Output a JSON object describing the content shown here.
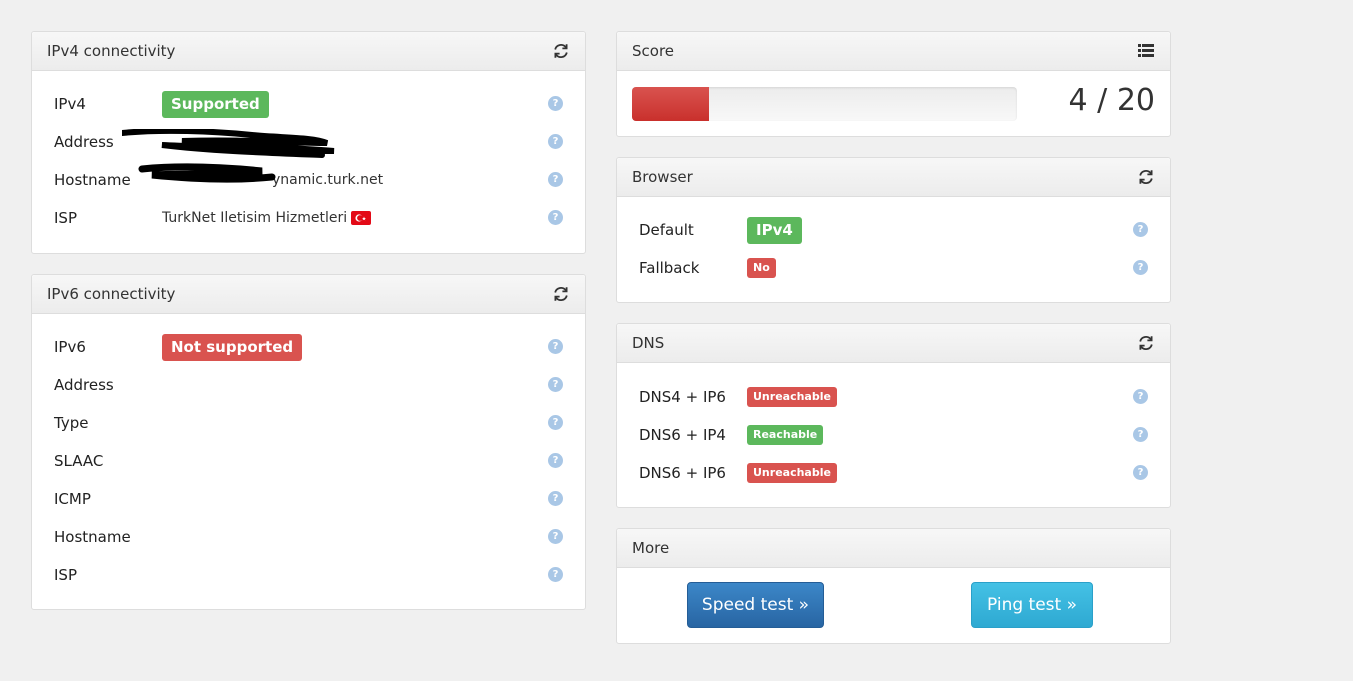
{
  "ipv4": {
    "title": "IPv4 connectivity",
    "rows": [
      {
        "label": "IPv4",
        "value": "Supported"
      },
      {
        "label": "Address",
        "value": ""
      },
      {
        "label": "Hostname",
        "value": "ynamic.turk.net"
      },
      {
        "label": "ISP",
        "value": "TurkNet Iletisim Hizmetleri"
      }
    ]
  },
  "ipv6": {
    "title": "IPv6 connectivity",
    "rows": [
      {
        "label": "IPv6",
        "value": "Not supported"
      },
      {
        "label": "Address",
        "value": ""
      },
      {
        "label": "Type",
        "value": ""
      },
      {
        "label": "SLAAC",
        "value": ""
      },
      {
        "label": "ICMP",
        "value": ""
      },
      {
        "label": "Hostname",
        "value": ""
      },
      {
        "label": "ISP",
        "value": ""
      }
    ]
  },
  "score": {
    "title": "Score",
    "text": "4 / 20",
    "fraction": 0.2
  },
  "browser": {
    "title": "Browser",
    "rows": [
      {
        "label": "Default",
        "value": "IPv4"
      },
      {
        "label": "Fallback",
        "value": "No"
      }
    ]
  },
  "dns": {
    "title": "DNS",
    "rows": [
      {
        "label": "DNS4 + IP6",
        "value": "Unreachable"
      },
      {
        "label": "DNS6 + IP4",
        "value": "Reachable"
      },
      {
        "label": "DNS6 + IP6",
        "value": "Unreachable"
      }
    ]
  },
  "more": {
    "title": "More",
    "speed_label": "Speed test »",
    "ping_label": "Ping test »"
  },
  "colors": {
    "success": "#5cb85c",
    "danger": "#d9534f",
    "primary": "#337ab7",
    "info": "#3bb6dd",
    "help": "#a9c7e6"
  },
  "icons": {
    "refresh": "refresh-icon",
    "list": "list-icon",
    "help": "help-icon",
    "flag": "turkey-flag-icon"
  },
  "help_glyph": "?"
}
